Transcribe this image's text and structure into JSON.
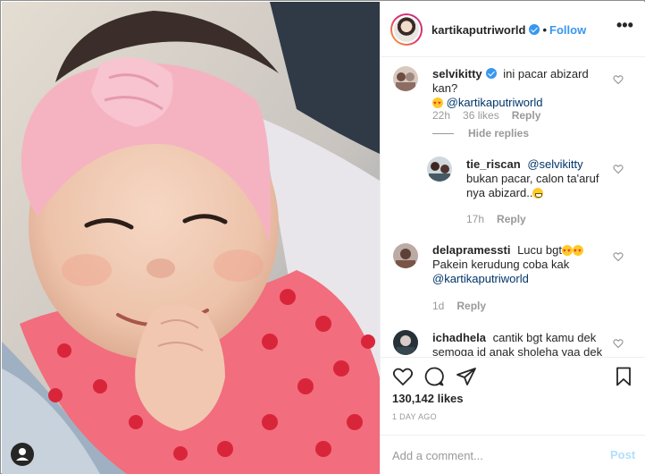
{
  "post": {
    "author": "kartikaputriworld",
    "follow_label": "Follow",
    "dot": "•",
    "more_label": "•••"
  },
  "comments": [
    {
      "user": "selvikitty",
      "verified": true,
      "text_1": "ini pacar abizard kan?",
      "text_2_mention": "@kartikaputriworld",
      "time": "22h",
      "likes": "36 likes",
      "reply": "Reply",
      "hide_replies": "Hide replies"
    },
    {
      "user": "tie_riscan",
      "mention": "@selvikitty",
      "text_1": "bukan pacar, calon ta'aruf",
      "text_2": "nya abizard..",
      "time": "17h",
      "reply": "Reply"
    },
    {
      "user": "delapramessti",
      "text_1": "Lucu bgt",
      "text_2": "Pakein kerudung coba kak",
      "text_3_mention": "@kartikaputriworld",
      "time": "1d",
      "reply": "Reply"
    },
    {
      "user": "ichadhela",
      "text_1": "cantik bgt kamu dek",
      "text_2": "semoga jd anak sholeha yaa dek"
    }
  ],
  "actions": {
    "likes": "130,142 likes",
    "date": "1 DAY AGO",
    "comment_placeholder": "Add a comment...",
    "post_label": "Post"
  },
  "icons": {
    "like": "heart-outline-icon",
    "comment": "speech-bubble-icon",
    "share": "paper-plane-icon",
    "save": "bookmark-icon",
    "comment_like": "small-heart-icon",
    "verified": "verified-badge-icon",
    "user": "user-silhouette-icon"
  },
  "colors": {
    "link": "#3897f0",
    "mention": "#003569",
    "muted": "#999999",
    "post_disabled": "#b2dffc"
  }
}
